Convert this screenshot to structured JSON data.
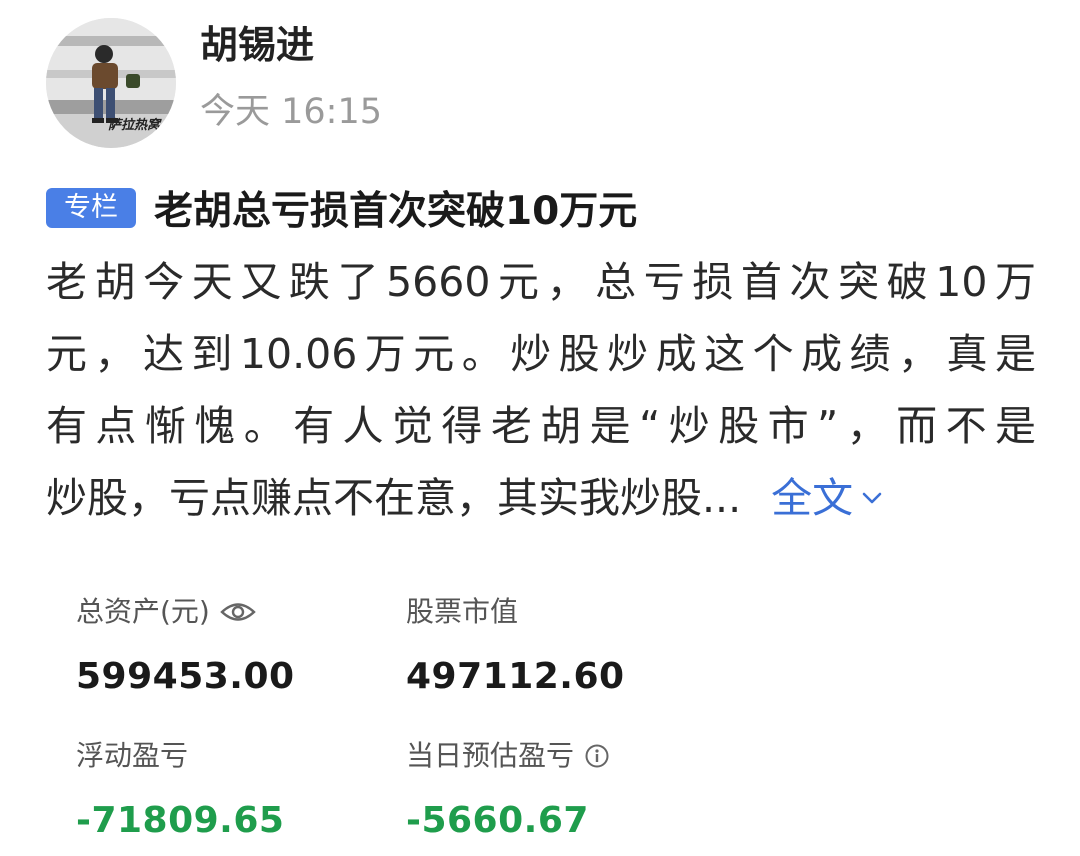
{
  "author": {
    "name": "胡锡进",
    "time": "今天 16:15",
    "avatar_caption": "萨拉热窝"
  },
  "post": {
    "badge": "专栏",
    "title": "老胡总亏损首次突破10万元",
    "body_lines": [
      "老胡今天又跌了5660元，总亏损首次突破10万",
      "元，达到10.06万元。炒股炒成这个成绩，真是",
      "有点惭愧。有人觉得老胡是“炒股市”，而不是",
      "炒股，亏点赚点不在意，其实我炒股..."
    ],
    "expand_label": "全文"
  },
  "stats": {
    "total_assets": {
      "label": "总资产(元)",
      "value": "599453.00",
      "icon": "eye-icon"
    },
    "market_value": {
      "label": "股票市值",
      "value": "497112.60"
    },
    "floating_pnl": {
      "label": "浮动盈亏",
      "value": "-71809.65"
    },
    "daily_pnl": {
      "label": "当日预估盈亏",
      "value": "-5660.67",
      "icon": "info-icon"
    }
  },
  "colors": {
    "badge": "#4a7fe6",
    "link": "#3a6fd6",
    "loss": "#1f9d4c",
    "muted": "#9a9a9a"
  }
}
